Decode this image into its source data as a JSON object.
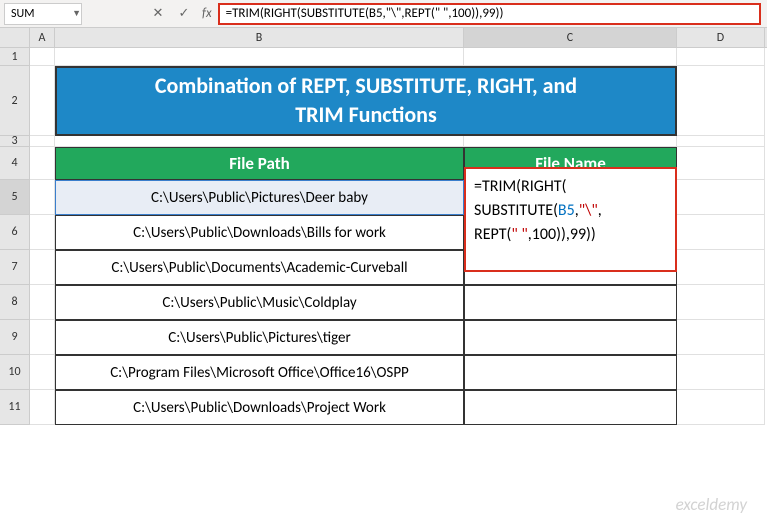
{
  "nameBox": "SUM",
  "formulaBar": "=TRIM(RIGHT(SUBSTITUTE(B5,\"\\\",REPT(\" \",100)),99))",
  "columns": {
    "a": "A",
    "b": "B",
    "c": "C",
    "d": "D"
  },
  "rowNums": {
    "r1": "1",
    "r2": "2",
    "r3": "3",
    "r4": "4",
    "r5": "5",
    "r6": "6",
    "r7": "7",
    "r8": "8",
    "r9": "9",
    "r10": "10",
    "r11": "11"
  },
  "title": {
    "line1": "Combination of REPT, SUBSTITUTE, RIGHT, and",
    "line2": "TRIM Functions"
  },
  "headers": {
    "path": "File Path",
    "name": "File Name"
  },
  "paths": {
    "p5": "C:\\Users\\Public\\Pictures\\Deer baby",
    "p6": "C:\\Users\\Public\\Downloads\\Bills for work",
    "p7": "C:\\Users\\Public\\Documents\\Academic-Curveball",
    "p8": "C:\\Users\\Public\\Music\\Coldplay",
    "p9": "C:\\Users\\Public\\Pictures\\tiger",
    "p10": "C:\\Program Files\\Microsoft Office\\Office16\\OSPP",
    "p11": "C:\\Users\\Public\\Downloads\\Project Work"
  },
  "formulaDisplay": {
    "eq": "=",
    "trim": "TRIM(",
    "right": "RIGHT(",
    "sub": "SUBSTITUTE(",
    "ref": "B5",
    "comma1": ",",
    "bslash": "\"\\\"",
    "comma2": ",",
    "rept": "REPT(",
    "space": "\" \"",
    "comma3": ",",
    "hundred": "100",
    "close1": ")),",
    "ninetynine": "99",
    "close2": "))"
  },
  "watermark": "exceldemy"
}
